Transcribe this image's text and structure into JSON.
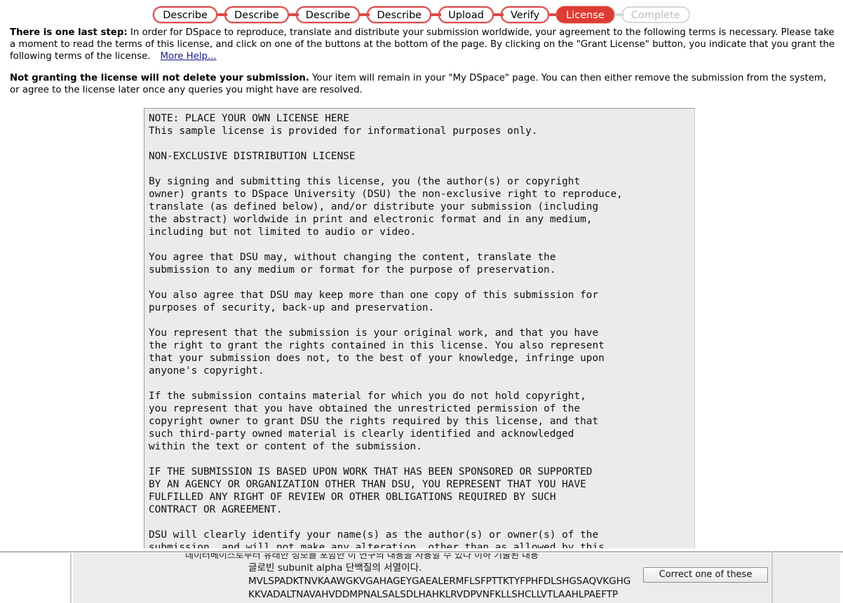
{
  "progress": {
    "steps": [
      {
        "label": "Describe",
        "state": "done"
      },
      {
        "label": "Describe",
        "state": "done"
      },
      {
        "label": "Describe",
        "state": "done"
      },
      {
        "label": "Describe",
        "state": "done"
      },
      {
        "label": "Upload",
        "state": "done"
      },
      {
        "label": "Verify",
        "state": "done"
      },
      {
        "label": "License",
        "state": "current"
      },
      {
        "label": "Complete",
        "state": "disabled"
      }
    ],
    "accent_color": "#d94b4b",
    "current_color": "#dd3c34",
    "disabled_color": "#bdbdbd"
  },
  "intro": {
    "p1_bold": "There is one last step:",
    "p1_text": " In order for DSpace to reproduce, translate and distribute your submission worldwide, your agreement to the following terms is necessary. Please take a moment to read the terms of this license, and click on one of the buttons at the bottom of the page. By clicking on the \"Grant License\" button, you indicate that you grant the following terms of the license.",
    "help_link": "More Help...",
    "p2_bold": "Not granting the license will not delete your submission.",
    "p2_text": " Your item will remain in your \"My DSpace\" page. You can then either remove the submission from the system, or agree to the license later once any queries you might have are resolved."
  },
  "license": {
    "text": "NOTE: PLACE YOUR OWN LICENSE HERE\nThis sample license is provided for informational purposes only.\n\nNON-EXCLUSIVE DISTRIBUTION LICENSE\n\nBy signing and submitting this license, you (the author(s) or copyright\nowner) grants to DSpace University (DSU) the non-exclusive right to reproduce,\ntranslate (as defined below), and/or distribute your submission (including\nthe abstract) worldwide in print and electronic format and in any medium,\nincluding but not limited to audio or video.\n\nYou agree that DSU may, without changing the content, translate the\nsubmission to any medium or format for the purpose of preservation.\n\nYou also agree that DSU may keep more than one copy of this submission for\npurposes of security, back-up and preservation.\n\nYou represent that the submission is your original work, and that you have\nthe right to grant the rights contained in this license. You also represent\nthat your submission does not, to the best of your knowledge, infringe upon\nanyone's copyright.\n\nIf the submission contains material for which you do not hold copyright,\nyou represent that you have obtained the unrestricted permission of the\ncopyright owner to grant DSU the rights required by this license, and that\nsuch third-party owned material is clearly identified and acknowledged\nwithin the text or content of the submission.\n\nIF THE SUBMISSION IS BASED UPON WORK THAT HAS BEEN SPONSORED OR SUPPORTED\nBY AN AGENCY OR ORGANIZATION OTHER THAN DSU, YOU REPRESENT THAT YOU HAVE\nFULFILLED ANY RIGHT OF REVIEW OR OTHER OBLIGATIONS REQUIRED BY SUCH\nCONTRACT OR AGREEMENT.\n\nDSU will clearly identify your name(s) as the author(s) or owner(s) of the\nsubmission, and will not make any alteration, other than as allowed by this"
  },
  "background": {
    "clipped_line": "데이터베이스로부터 유래한 정보를 포함한 이 연구의 내용을 사용할 수 있다 이하 기술된 내용",
    "line_korean": "글로빈 subunit alpha 단백질의 서열이다.",
    "line_seq_1": "MVLSPADKTNVKAAWGKVGAHAGEYGAEALERMFLSFPTTKTYFPHFDLSHGSAQVKGHG",
    "line_seq_2": "KKVADALTNAVAHVDDMPNALSALSDLHAHKLRVDPVNFKLLSHCLLVTLAAHLPAEFTP",
    "correct_button": "Correct one of these"
  }
}
